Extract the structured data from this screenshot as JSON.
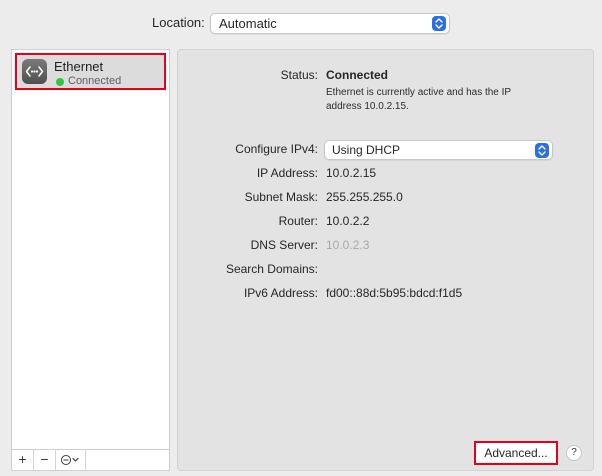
{
  "location": {
    "label": "Location:",
    "value": "Automatic"
  },
  "sidebar": {
    "services": [
      {
        "name": "Ethernet",
        "status": "Connected",
        "status_color": "#2fc844",
        "icon": "ethernet-icon"
      }
    ],
    "footer": {
      "add_label": "+",
      "remove_label": "−",
      "action_icon": "action-menu-icon"
    }
  },
  "detail": {
    "status_label": "Status:",
    "status_value": "Connected",
    "status_description": "Ethernet is currently active and has the IP address 10.0.2.15.",
    "configure_label": "Configure IPv4:",
    "configure_value": "Using DHCP",
    "ip_label": "IP Address:",
    "ip_value": "10.0.2.15",
    "subnet_label": "Subnet Mask:",
    "subnet_value": "255.255.255.0",
    "router_label": "Router:",
    "router_value": "10.0.2.2",
    "dns_label": "DNS Server:",
    "dns_value": "10.0.2.3",
    "search_domains_label": "Search Domains:",
    "ipv6_label": "IPv6 Address:",
    "ipv6_value": "fd00::88d:5b95:bdcd:f1d5",
    "advanced_label": "Advanced...",
    "help_label": "?"
  },
  "colors": {
    "accent": "#2b6fe0",
    "highlight_border": "#e5001c"
  }
}
